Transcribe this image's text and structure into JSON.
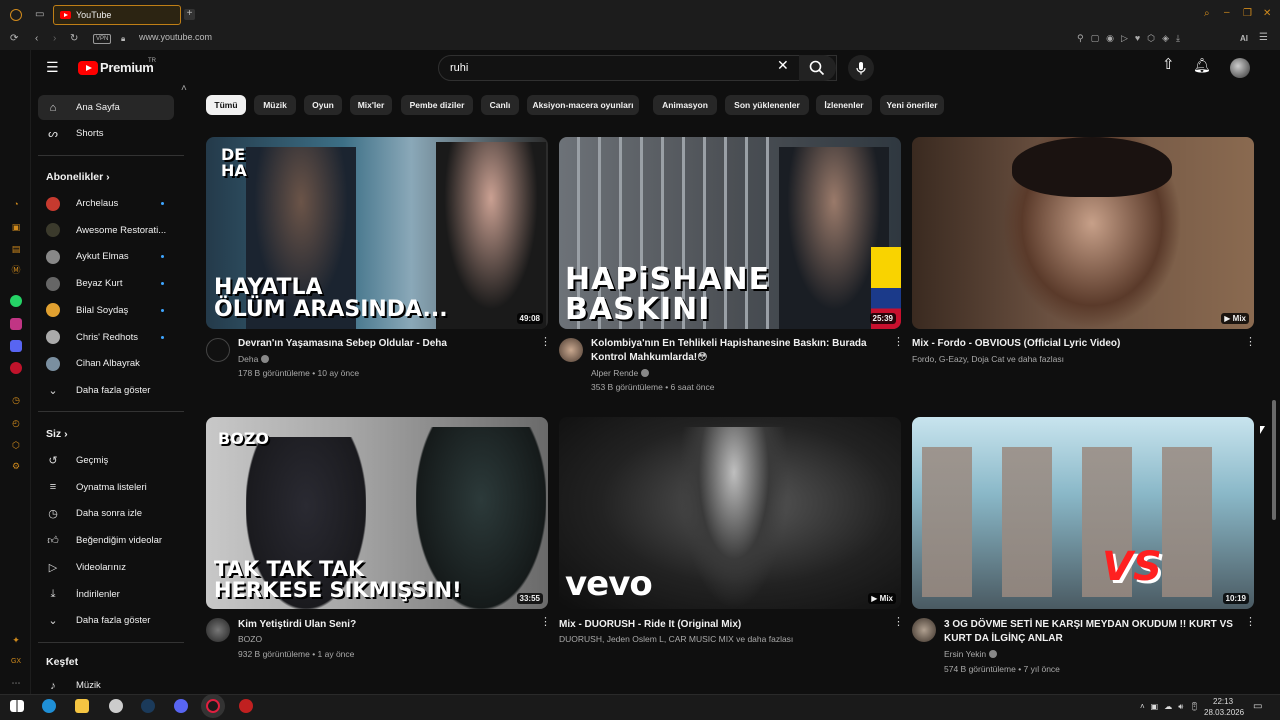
{
  "browser": {
    "tab_title": "YouTube",
    "url": "www.youtube.com",
    "vpn_label": "VPN",
    "ai_label": "AI"
  },
  "header": {
    "logo_text": "Premium",
    "logo_tr": "TR",
    "search_value": "ruhi"
  },
  "nav": {
    "home": "Ana Sayfa",
    "shorts": "Shorts",
    "subscriptions": "Abonelikler",
    "subs": [
      {
        "name": "Archelaus",
        "color": "#c63a2f",
        "dot": true
      },
      {
        "name": "Awesome Restorati...",
        "color": "#3b3a2c",
        "dot": false
      },
      {
        "name": "Aykut Elmas",
        "color": "#888888",
        "dot": true
      },
      {
        "name": "Beyaz Kurt",
        "color": "#666666",
        "dot": true
      },
      {
        "name": "Bilal Soydaş",
        "color": "#e0a030",
        "dot": true
      },
      {
        "name": "Chris' Redhots",
        "color": "#aaaaaa",
        "dot": true
      },
      {
        "name": "Cihan Albayrak",
        "color": "#7a8fa0",
        "dot": false
      }
    ],
    "show_more_1": "Daha fazla göster",
    "you": "Siz",
    "you_items": [
      "Geçmiş",
      "Oynatma listeleri",
      "Daha sonra izle",
      "Beğendiğim videolar",
      "Videolarınız",
      "İndirilenler"
    ],
    "show_more_2": "Daha fazla göster",
    "explore": "Keşfet",
    "music": "Müzik"
  },
  "chips": [
    "Tümü",
    "Müzik",
    "Oyun",
    "Mix'ler",
    "Pembe diziler",
    "Canlı",
    "Aksiyon-macera oyunları",
    "Animasyon",
    "Son yüklenenler",
    "İzlenenler",
    "Yeni öneriler"
  ],
  "videos": [
    {
      "title": "Devran'ın Yaşamasına Sebep Oldular - Deha",
      "title2": "",
      "channel": "Deha",
      "verified": true,
      "stats": "178 B görüntüleme • 10 ay önce",
      "duration": "49:08",
      "caption": "HAYATLA\nÖLÜM ARASINDA...",
      "corner": "DE\nHA"
    },
    {
      "title": "Kolombiya'nın En Tehlikeli Hapishanesine Baskın: Burada",
      "title2": "Kontrol Mahkumlarda!😳",
      "channel": "Alper Rende",
      "verified": true,
      "stats": "353 B görüntüleme • 6 saat önce",
      "duration": "25:39",
      "caption": "HAPiSHANE\nBASKINI"
    },
    {
      "title": "Mix - Fordo - OBVIOUS (Official Lyric Video)",
      "title2": "",
      "channel": "Fordo, G-Eazy, Doja Cat ve daha fazlası",
      "verified": false,
      "stats": "",
      "duration": "Mix"
    },
    {
      "title": "Kim Yetiştirdi Ulan Seni?",
      "title2": "",
      "channel": "BOZO",
      "verified": false,
      "stats": "932 B görüntüleme • 1 ay önce",
      "duration": "33:55",
      "caption": "TAK TAK TAK\nHERKESE SIKMIŞSIN!",
      "corner": "BOZO"
    },
    {
      "title": "Mix - DUORUSH - Ride It (Original Mix)",
      "title2": "",
      "channel": "DUORUSH, Jeden Oslem L, CAR MUSIC MIX ve daha fazlası",
      "verified": false,
      "stats": "",
      "duration": "Mix",
      "caption": "vevo"
    },
    {
      "title": "3 OG DÖVME SETİ NE KARŞI MEYDAN OKUDUM !! KURT VS",
      "title2": "KURT DA İLGİNÇ ANLAR",
      "channel": "Ersin Yekin",
      "verified": true,
      "stats": "574 B görüntüleme • 7 yıl önce",
      "duration": "10:19",
      "caption": "VS"
    }
  ],
  "taskbar": {
    "time": "22:13",
    "date": "28.03.2026"
  }
}
